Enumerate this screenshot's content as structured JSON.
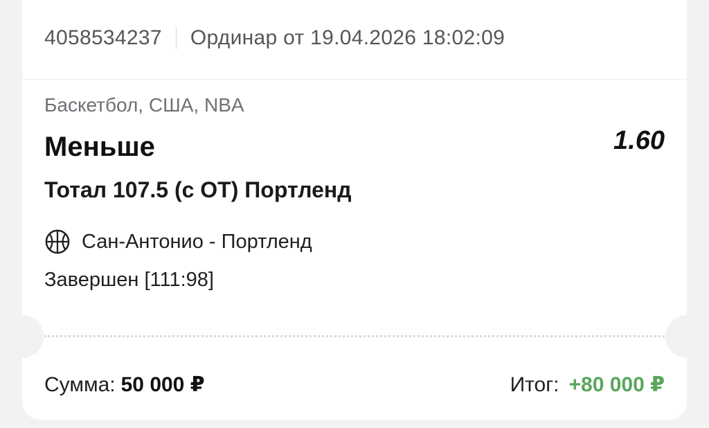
{
  "ticket": {
    "id": "4058534237",
    "type_and_date": "Ординар от 19.04.2026 18:02:09"
  },
  "bet": {
    "category": "Баскетбол, США, NBA",
    "outcome": "Меньше",
    "odds": "1.60",
    "market": "Тотал 107.5 (с ОТ) Портленд",
    "sport_icon": "basketball-icon",
    "match": "Сан-Антонио - Портленд",
    "status": "Завершен [111:98]"
  },
  "footer": {
    "stake_label": "Сумма:",
    "stake_value": "50 000 ₽",
    "result_label": "Итог:",
    "result_value": "+80 000 ₽"
  },
  "colors": {
    "win_green": "#5aa65d",
    "background": "#f2f2f4",
    "card": "#ffffff"
  }
}
